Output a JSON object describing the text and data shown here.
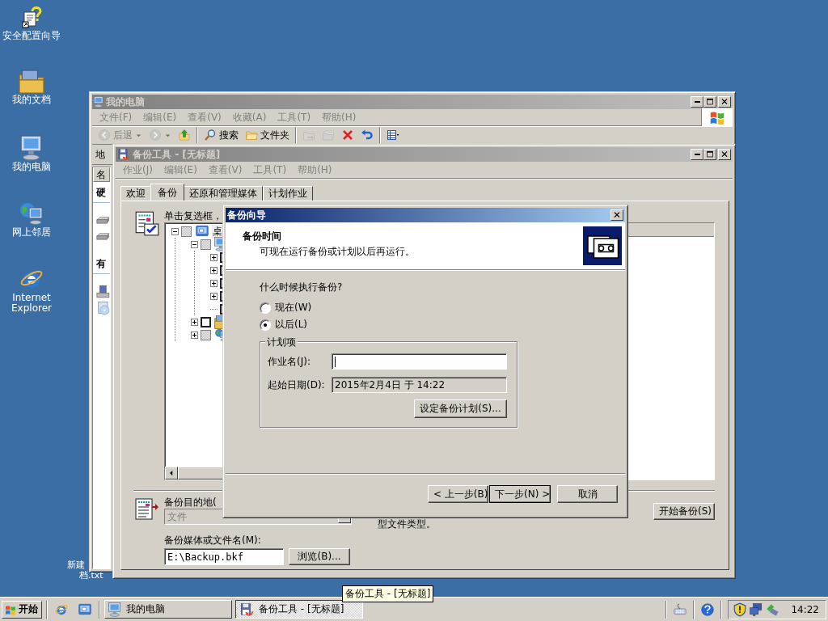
{
  "desktop_icons": [
    {
      "label": "安全配置向导",
      "kind": "wizard"
    },
    {
      "label": "我的文档",
      "kind": "documents"
    },
    {
      "label": "我的电脑",
      "kind": "computer"
    },
    {
      "label": "网上邻居",
      "kind": "network"
    },
    {
      "label": "Internet Explorer",
      "kind": "browser"
    }
  ],
  "desktop_file_label": [
    "新建",
    "档.txt"
  ],
  "explorer_window": {
    "title": "我的电脑",
    "active": false,
    "menu": [
      "文件(F)",
      "编辑(E)",
      "查看(V)",
      "收藏(A)",
      "工具(T)",
      "帮助(H)"
    ],
    "toolbar": [
      {
        "kind": "back",
        "label": "后退",
        "disabled": true
      },
      {
        "kind": "forward",
        "disabled": true
      },
      {
        "kind": "up",
        "disabled": false
      },
      {
        "kind": "search",
        "label": "搜索",
        "disabled": false
      },
      {
        "kind": "folders",
        "label": "文件夹",
        "disabled": false
      },
      {
        "kind": "move",
        "disabled": true
      },
      {
        "kind": "copy",
        "disabled": true
      },
      {
        "kind": "delete",
        "disabled": false
      },
      {
        "kind": "undo",
        "disabled": false
      },
      {
        "kind": "views",
        "disabled": false
      }
    ],
    "address_label": "地",
    "column_header": "名",
    "groups": [
      {
        "heading": "硬",
        "items": [
          {
            "kind": "drive"
          },
          {
            "kind": "drive"
          }
        ]
      },
      {
        "heading": "有",
        "items": [
          {
            "kind": "removable"
          },
          {
            "kind": "cd"
          }
        ]
      }
    ]
  },
  "backup_window": {
    "title": "备份工具 - [无标题]",
    "active": false,
    "menu": [
      "作业(J)",
      "编辑(E)",
      "查看(V)",
      "工具(T)",
      "帮助(H)"
    ],
    "tabs": [
      {
        "label": "欢迎",
        "selected": false
      },
      {
        "label": "备份",
        "selected": true
      },
      {
        "label": "还原和管理媒体",
        "selected": false
      },
      {
        "label": "计划作业",
        "selected": false
      }
    ],
    "instruction": "单击复选框，",
    "tree": [
      {
        "label": "桌",
        "kind": "desktop",
        "checked": false,
        "shaded": true,
        "expanded": true,
        "children": [
          {
            "kind": "computer",
            "checked": false,
            "shaded": true,
            "expanded": true,
            "children": [
              {
                "checked": false,
                "shaded": false,
                "expanded": false
              },
              {
                "checked": false,
                "shaded": false,
                "expanded": false
              },
              {
                "checked": false,
                "shaded": false,
                "expanded": false
              },
              {
                "checked": false,
                "shaded": false,
                "expanded": false
              },
              {
                "checked": false,
                "shaded": false
              }
            ]
          },
          {
            "kind": "documents",
            "checked": false,
            "shaded": false,
            "expanded": false
          },
          {
            "kind": "network",
            "checked": false,
            "shaded": true,
            "expanded": false
          }
        ]
      }
    ],
    "destination": {
      "label": "备份目的地(",
      "value": "文件",
      "disabled": true
    },
    "media": {
      "label": "备份媒体或文件名(M):",
      "value": "E:\\Backup.bkf"
    },
    "browse_button": "浏览(B)...",
    "note": "型文件类型。",
    "start_button": "开始备份(S)"
  },
  "wizard_dialog": {
    "title": "备份向导",
    "active": true,
    "heading": "备份时间",
    "subheading": "可现在运行备份或计划以后再运行。",
    "question": "什么时候执行备份?",
    "options": [
      {
        "label": "现在(W)",
        "selected": false
      },
      {
        "label": "以后(L)",
        "selected": true
      }
    ],
    "group_title": "计划项",
    "job_name": {
      "label": "作业名(J):",
      "focused": true
    },
    "start_date": {
      "label": "起始日期(D):",
      "value": "2015年2月4日 于 14:22",
      "disabled": true
    },
    "schedule_button": "设定备份计划(S)...",
    "buttons": [
      {
        "label": "< 上一步(B)",
        "default": false
      },
      {
        "label": "下一步(N) >",
        "default": true
      },
      {
        "label": "取消",
        "default": false
      }
    ]
  },
  "tooltip": "备份工具 - [无标题]",
  "taskbar": {
    "start_label": "开始",
    "quick_launch": [
      {
        "kind": "browser"
      },
      {
        "kind": "desktop"
      }
    ],
    "tasks": [
      {
        "label": "我的电脑",
        "kind": "computer",
        "selected": false
      },
      {
        "label": "备份工具 - [无标题]",
        "kind": "backup",
        "selected": true
      }
    ],
    "tray": [
      {
        "kind": "keyboard"
      },
      {
        "kind": "help"
      }
    ],
    "notify": [
      {
        "kind": "shield"
      },
      {
        "kind": "network_tray"
      },
      {
        "kind": "connection"
      }
    ],
    "clock": "14:22"
  }
}
